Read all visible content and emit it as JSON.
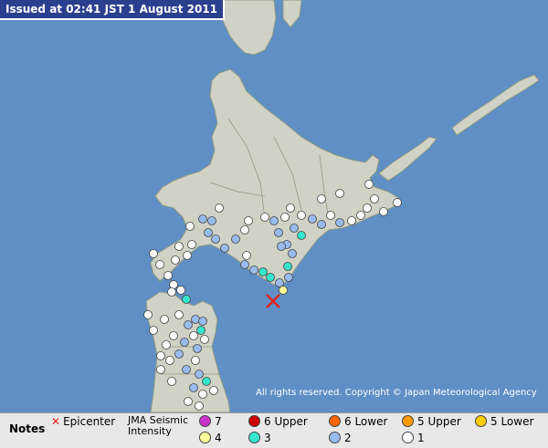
{
  "header": {
    "issued": "Issued at 02:41 JST  1 August 2011"
  },
  "map": {
    "copyright": "All rights reserved. Copyright © Japan Meteorological Agency",
    "colors": {
      "sea": "#5f8fc4",
      "land": "#cfd2c4",
      "border": "#8f9a85",
      "epicenter": "#e0261f"
    }
  },
  "legend": {
    "notes": "Notes",
    "epicenter_label": "Epicenter",
    "scale_label_1": "JMA Seismic",
    "scale_label_2": "Intensity",
    "levels": [
      {
        "label": "7",
        "color": "#cc33cc"
      },
      {
        "label": "6 Upper",
        "color": "#cc0000"
      },
      {
        "label": "6 Lower",
        "color": "#ff6600"
      },
      {
        "label": "5 Upper",
        "color": "#ff9900"
      },
      {
        "label": "5 Lower",
        "color": "#ffcc00"
      },
      {
        "label": "4",
        "color": "#ffff99"
      },
      {
        "label": "3",
        "color": "#33e6cc"
      },
      {
        "label": "2",
        "color": "#99bbee"
      },
      {
        "label": "1",
        "color": "#ffffff"
      }
    ]
  }
}
